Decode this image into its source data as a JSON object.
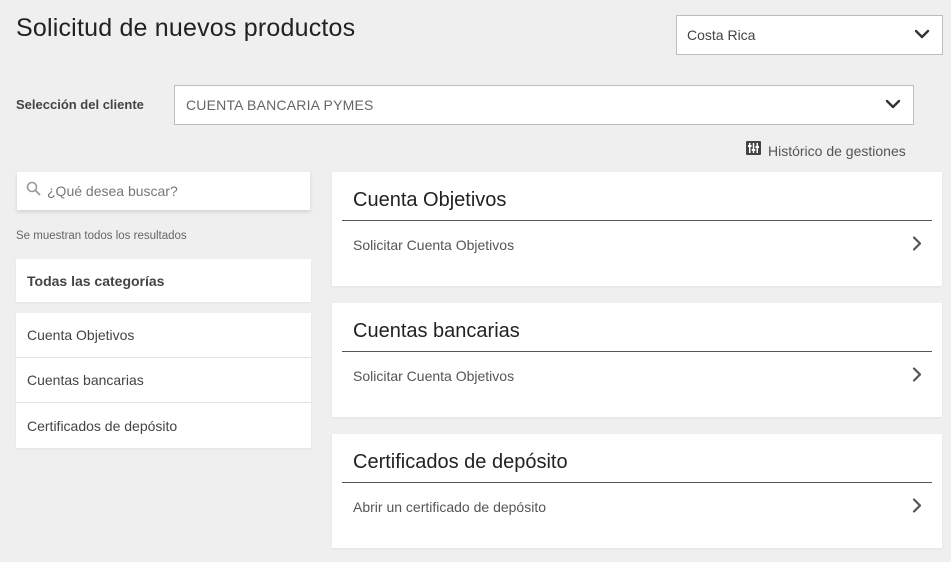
{
  "header": {
    "title": "Solicitud de nuevos productos",
    "country": {
      "value": "Costa Rica"
    }
  },
  "client": {
    "label": "Selección del cliente",
    "value": "CUENTA BANCARIA PYMES"
  },
  "history": {
    "label": "Histórico de gestiones",
    "icon": "sliders-icon"
  },
  "sidebar": {
    "search_placeholder": "¿Qué desea buscar?",
    "results_note": "Se muestran todos los resultados",
    "all_categories": "Todas las categorías",
    "categories": [
      {
        "label": "Cuenta Objetivos"
      },
      {
        "label": "Cuentas bancarias"
      },
      {
        "label": "Certificados de depósito"
      }
    ]
  },
  "cards": [
    {
      "title": "Cuenta Objetivos",
      "action": "Solicitar Cuenta Objetivos"
    },
    {
      "title": "Cuentas bancarias",
      "action": "Solicitar Cuenta Objetivos"
    },
    {
      "title": "Certificados de depósito",
      "action": "Abrir un certificado de depósito"
    }
  ]
}
